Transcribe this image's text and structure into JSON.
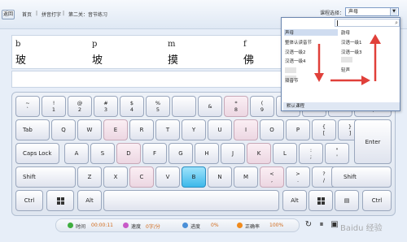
{
  "nav": {
    "back": "返回",
    "crumbs": [
      "首页",
      "拼音打字",
      "第二关：音节练习"
    ],
    "separator": "|",
    "course_label": "课程选择：",
    "course_value": "声母"
  },
  "dropdown": {
    "left_items": [
      "声母",
      "整体认读音节",
      "汉语一级2",
      "汉语一级4",
      "双音节"
    ],
    "right_items": [
      "韵母",
      "汉语一级1",
      "汉语一级3",
      "轻声"
    ],
    "footer": "默认课程",
    "arrow_color": "#e0403a"
  },
  "practice": {
    "pinyin": [
      "b",
      "p",
      "m",
      "f"
    ],
    "hanzi": [
      "玻",
      "坡",
      "摸",
      "佛"
    ]
  },
  "keyboard": {
    "row1": [
      [
        "~",
        "`"
      ],
      [
        "!",
        "1"
      ],
      [
        "@",
        "2"
      ],
      [
        "#",
        "3"
      ],
      [
        "$",
        "4"
      ],
      [
        "%",
        "5"
      ],
      [
        "&",
        "6"
      ],
      [
        "*",
        "8"
      ],
      [
        "(",
        "9"
      ],
      [
        ")",
        "0"
      ],
      [
        "_",
        "-"
      ],
      [
        "+",
        "="
      ],
      [
        "|",
        "\\"
      ]
    ],
    "tab": "Tab",
    "row2": [
      "Q",
      "W",
      "E",
      "R",
      "T",
      "Y",
      "U",
      "I",
      "O",
      "P"
    ],
    "row2_brackets": [
      [
        "{",
        "["
      ],
      [
        "}",
        "]"
      ]
    ],
    "capslock": "Caps Lock",
    "row3": [
      "A",
      "S",
      "D",
      "F",
      "G",
      "H",
      "J",
      "K",
      "L"
    ],
    "row3_punct": [
      [
        ":",
        ";"
      ],
      [
        "\"",
        "'"
      ]
    ],
    "enter": "Enter",
    "shift": "Shift",
    "row4": [
      "Z",
      "X",
      "C",
      "V",
      "B",
      "N",
      "M"
    ],
    "row4_punct": [
      [
        "<",
        ","
      ],
      [
        ">",
        "."
      ],
      [
        "?",
        "/"
      ]
    ],
    "ctrl": "Ctrl",
    "alt": "Alt",
    "highlight_color": "#3db8ea"
  },
  "status": {
    "time_label": "时间",
    "time_value": "00:00:11",
    "speed_label": "速度",
    "speed_value": "0字/分",
    "progress_label": "进度",
    "progress_value": "0%",
    "accuracy_label": "正确率",
    "accuracy_value": "100%"
  },
  "watermark": "Baidu 经验"
}
